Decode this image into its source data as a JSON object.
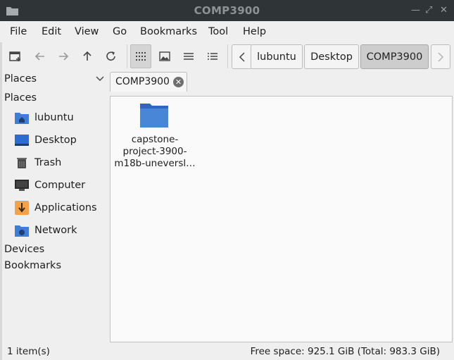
{
  "window": {
    "title": "COMP3900"
  },
  "menu": [
    "File",
    "Edit",
    "View",
    "Go",
    "Bookmarks",
    "Tool",
    "Help"
  ],
  "toolbar": {
    "buttons": [
      "new-tab-icon",
      "back-icon",
      "forward-icon",
      "up-icon",
      "reload-icon",
      "icon-view-icon",
      "thumbnail-view-icon",
      "compact-view-icon",
      "detailed-list-icon"
    ],
    "breadcrumbs": [
      "lubuntu",
      "Desktop",
      "COMP3900"
    ]
  },
  "sidebar": {
    "selector_label": "Places",
    "section_places": "Places",
    "items": [
      {
        "label": "lubuntu",
        "icon": "home-folder-icon"
      },
      {
        "label": "Desktop",
        "icon": "desktop-icon"
      },
      {
        "label": "Trash",
        "icon": "trash-icon"
      },
      {
        "label": "Computer",
        "icon": "computer-icon"
      },
      {
        "label": "Applications",
        "icon": "applications-icon"
      },
      {
        "label": "Network",
        "icon": "network-icon"
      }
    ],
    "section_devices": "Devices",
    "section_bookmarks": "Bookmarks"
  },
  "tab": {
    "label": "COMP3900"
  },
  "files": [
    {
      "line1": "capstone-",
      "line2": "project-3900-",
      "line3": "m18b-uneversl…",
      "icon": "folder-icon"
    }
  ],
  "status": {
    "items": "1 item(s)",
    "free_space": "Free space: 925.1 GiB (Total: 983.3 GiB)"
  },
  "colors": {
    "titlebar": "#2f3436",
    "folder": "#4a86d8",
    "accent": "#3f7dd6"
  }
}
